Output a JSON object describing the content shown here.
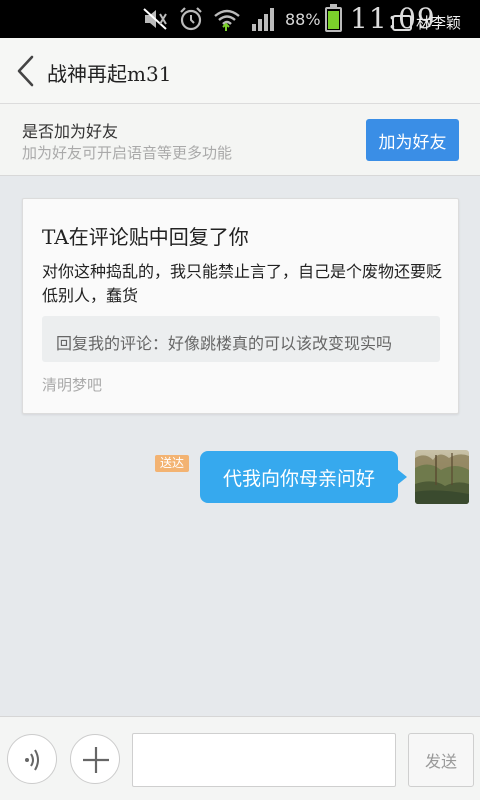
{
  "status_bar": {
    "icons": [
      "mute-icon",
      "alarm-icon",
      "wifi-icon",
      "signal-icon"
    ],
    "battery_percent": "88%",
    "battery_level": 0.88,
    "clock": "11:09 AM",
    "carrier": "林李颖"
  },
  "header": {
    "title": "战神再起m31"
  },
  "friend_bar": {
    "title": "是否加为好友",
    "subtitle": "加为好友可开启语音等更多功能",
    "add_button": "加为好友"
  },
  "notification_card": {
    "title": "TA在评论贴中回复了你",
    "body": "对你这种捣乱的，我只能禁止言了，自己是个废物还要贬低别人，蠢货",
    "quote": "回复我的评论：好像跳楼真的可以该改变现实吗",
    "source": "清明梦吧"
  },
  "messages": [
    {
      "status": "送达",
      "text": "代我向你母亲问好"
    }
  ],
  "input_bar": {
    "placeholder": "",
    "send_label": "发送"
  },
  "colors": {
    "accent": "#3a8ee6",
    "bubble": "#36a9ee",
    "status_badge": "#f3b372"
  }
}
